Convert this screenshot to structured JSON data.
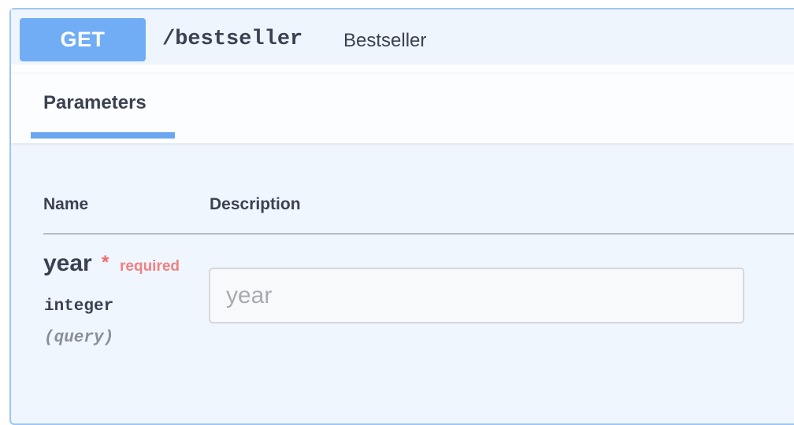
{
  "operation": {
    "method": "GET",
    "path": "/bestseller",
    "summary": "Bestseller"
  },
  "tabs": [
    {
      "label": "Parameters",
      "active": true
    }
  ],
  "table": {
    "columns": [
      "Name",
      "Description"
    ]
  },
  "parameters": [
    {
      "name": "year",
      "required_marker": "*",
      "required_label": "required",
      "type": "integer",
      "in": "(query)",
      "input_value": "",
      "placeholder": "year"
    }
  ],
  "colors": {
    "method_bg": "#71adf5",
    "block_bg": "#eff6fe",
    "block_border": "#9fc6f2",
    "required": "#f08080",
    "text": "#3b4151"
  }
}
